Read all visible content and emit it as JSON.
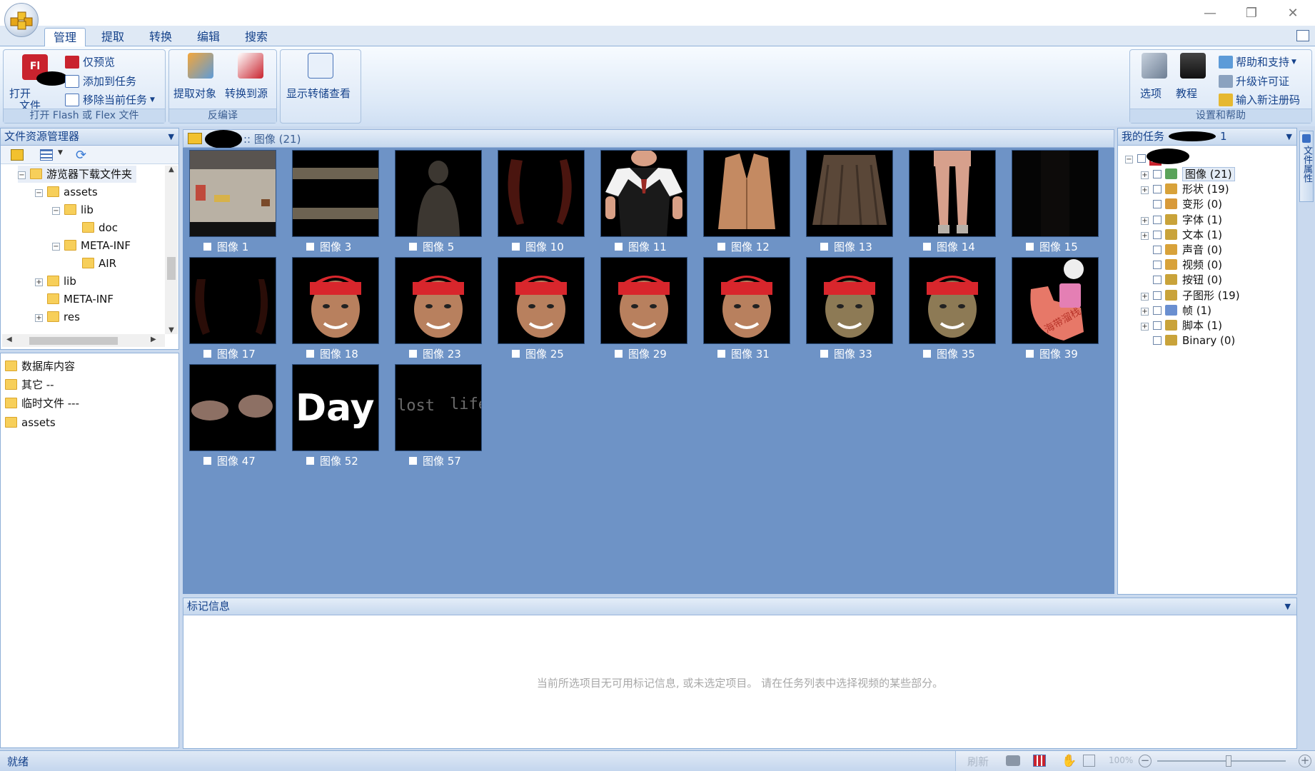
{
  "tabs": [
    "管理",
    "提取",
    "转换",
    "编辑",
    "搜索"
  ],
  "ribbon": {
    "open_label": "打开",
    "open_sub": "文件",
    "preview_only": "仅预览",
    "add_to_task": "添加到任务",
    "remove_current": "移除当前任务",
    "group1": "打开 Flash 或 Flex 文件",
    "extract_objects": "提取对象",
    "convert_to_source": "转换到源",
    "group2": "反编译",
    "show_dump": "显示转储查看",
    "options": "选项",
    "tutorial": "教程",
    "help_support": "帮助和支持",
    "upgrade_license": "升级许可证",
    "enter_reg_code": "输入新注册码",
    "group_help": "设置和帮助"
  },
  "explorer": {
    "title": "文件资源管理器",
    "tree": [
      {
        "label": "游览器下载文件夹",
        "expander": "−"
      },
      {
        "label": "assets",
        "expander": "−"
      },
      {
        "label": "lib",
        "expander": "−"
      },
      {
        "label": "doc",
        "expander": ""
      },
      {
        "label": "META-INF",
        "expander": "−"
      },
      {
        "label": "AIR",
        "expander": ""
      },
      {
        "label": "lib",
        "expander": "+"
      },
      {
        "label": "META-INF",
        "expander": ""
      },
      {
        "label": "res",
        "expander": "+"
      }
    ],
    "quick": [
      "数据库内容",
      "其它 --",
      "临时文件 ---",
      "assets"
    ]
  },
  "content": {
    "breadcrumb": ":: 图像 (21)",
    "items": [
      {
        "label": "图像 1",
        "kind": "scene"
      },
      {
        "label": "图像 3",
        "kind": "stripes"
      },
      {
        "label": "图像 5",
        "kind": "ghost"
      },
      {
        "label": "图像 10",
        "kind": "sleeves"
      },
      {
        "label": "图像 11",
        "kind": "shirt"
      },
      {
        "label": "图像 12",
        "kind": "vest"
      },
      {
        "label": "图像 13",
        "kind": "skirt"
      },
      {
        "label": "图像 14",
        "kind": "legs"
      },
      {
        "label": "图像 15",
        "kind": "dark"
      },
      {
        "label": "图像 17",
        "kind": "sleeves2"
      },
      {
        "label": "图像 18",
        "kind": "face"
      },
      {
        "label": "图像 23",
        "kind": "face"
      },
      {
        "label": "图像 25",
        "kind": "face"
      },
      {
        "label": "图像 29",
        "kind": "face"
      },
      {
        "label": "图像 31",
        "kind": "face"
      },
      {
        "label": "图像 33",
        "kind": "face2"
      },
      {
        "label": "图像 35",
        "kind": "face2"
      },
      {
        "label": "图像 39",
        "kind": "arm"
      },
      {
        "label": "图像 47",
        "kind": "shoes"
      },
      {
        "label": "图像 52",
        "kind": "day"
      },
      {
        "label": "图像 57",
        "kind": "lostlife"
      }
    ],
    "thumb_text_day": "Day",
    "thumb_text_lost": "lost",
    "thumb_text_life": "life",
    "thumb_text_arm": "海带溜栈"
  },
  "tags": {
    "title": "标记信息",
    "message": "当前所选项目无可用标记信息, 或未选定项目。 请在任务列表中选择视频的某些部分。"
  },
  "tasks": {
    "title": "我的任务",
    "count": "1",
    "root_badge": "FL",
    "items": [
      {
        "label": "图像 (21)",
        "expander": "+",
        "color": "#5aa35a"
      },
      {
        "label": "形状 (19)",
        "expander": "+",
        "color": "#d8a23a"
      },
      {
        "label": "变形 (0)",
        "expander": "",
        "color": "#d89a3a"
      },
      {
        "label": "字体 (1)",
        "expander": "+",
        "color": "#c9a33a"
      },
      {
        "label": "文本 (1)",
        "expander": "+",
        "color": "#c9a33a"
      },
      {
        "label": "声音 (0)",
        "expander": "",
        "color": "#d8a23a"
      },
      {
        "label": "视频 (0)",
        "expander": "",
        "color": "#d8a23a"
      },
      {
        "label": "按钮 (0)",
        "expander": "",
        "color": "#c9a33a"
      },
      {
        "label": "子图形 (19)",
        "expander": "+",
        "color": "#c9a33a"
      },
      {
        "label": "帧 (1)",
        "expander": "+",
        "color": "#6a8fd0"
      },
      {
        "label": "脚本 (1)",
        "expander": "+",
        "color": "#c9a33a"
      },
      {
        "label": "Binary (0)",
        "expander": "",
        "color": "#c9a33a"
      }
    ]
  },
  "side_tab": "文件属性",
  "status": {
    "text": "就绪",
    "refresh": "刷新",
    "zoom": "100%"
  }
}
